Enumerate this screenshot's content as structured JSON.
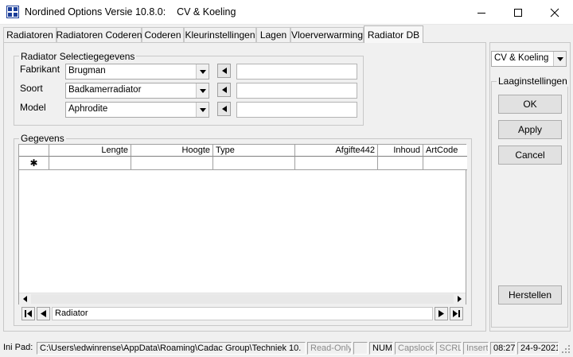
{
  "window": {
    "title": "Nordined Options Versie 10.8.0:    CV & Koeling"
  },
  "tabs": [
    {
      "label": "Radiatoren"
    },
    {
      "label": "Radiatoren Coderen"
    },
    {
      "label": "Coderen"
    },
    {
      "label": "Kleurinstellingen"
    },
    {
      "label": "Lagen"
    },
    {
      "label": "Vloerverwarming"
    },
    {
      "label": "Radiator DB",
      "active": true
    }
  ],
  "selection_group": {
    "title": "Radiator Selectiegegevens",
    "fields": [
      {
        "label": "Fabrikant",
        "value": "Brugman",
        "text": ""
      },
      {
        "label": "Soort",
        "value": "Badkamerradiator",
        "text": ""
      },
      {
        "label": "Model",
        "value": "Aphrodite",
        "text": ""
      }
    ]
  },
  "data_group": {
    "title": "Gegevens",
    "columns": [
      "Lengte",
      "Hoogte",
      "Type",
      "Afgifte442",
      "Inhoud",
      "ArtCode"
    ],
    "new_row_marker": "✱",
    "navigator_label": "Radiator"
  },
  "right_pane": {
    "mode": "CV & Koeling",
    "settings_title": "Laaginstellingen",
    "ok_label": "OK",
    "apply_label": "Apply",
    "cancel_label": "Cancel",
    "reset_label": "Herstellen"
  },
  "statusbar": {
    "ini_label": "Ini Pad:",
    "path": "C:\\Users\\edwinrense\\AppData\\Roaming\\Cadac Group\\Techniek 10.",
    "readonly": "Read-Only",
    "num": "NUM",
    "capslock": "Capslock",
    "scrl": "SCRL",
    "insert": "Insert",
    "time": "08:27",
    "date": "24-9-2021"
  },
  "colors": {
    "icon_blue": "#1a3d99",
    "border": "#c8c8c8",
    "button_face": "#e1e1e1"
  }
}
